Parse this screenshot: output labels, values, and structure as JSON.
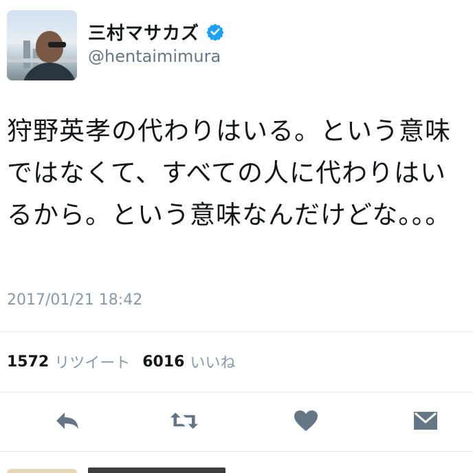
{
  "author": {
    "display_name": "三村マサカズ",
    "handle": "@hentaimimura",
    "verified": true
  },
  "tweet": {
    "text": "狩野英孝の代わりはいる。という意味ではなくて、すべての人に代わりはいるから。という意味なんだけどな。。。",
    "timestamp": "2017/01/21 18:42"
  },
  "stats": {
    "retweets": "1572",
    "retweets_label": "リツイート",
    "likes": "6016",
    "likes_label": "いいね"
  },
  "actions": [
    "reply-icon",
    "retweet-icon",
    "like-icon",
    "dm-icon"
  ],
  "colors": {
    "verified_blue": "#1da1f2",
    "action_gray": "#657786",
    "secondary_text": "#8899a6",
    "divider": "#e1e8ed"
  }
}
